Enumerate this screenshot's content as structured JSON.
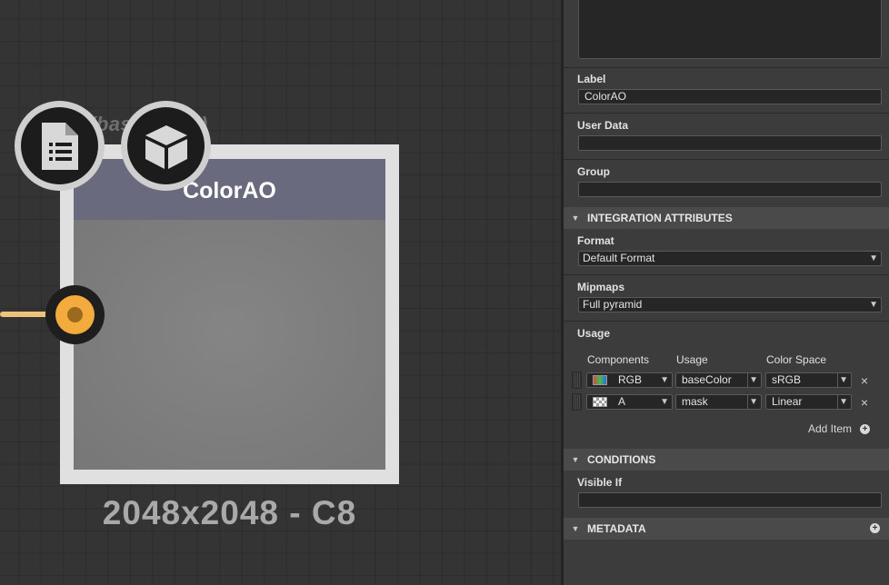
{
  "canvas": {
    "node": {
      "title": "ColorAO",
      "ghost_label": "(base color)",
      "resolution": "2048x2048 - C8",
      "badges": [
        "document-icon",
        "cube-icon"
      ]
    }
  },
  "panel": {
    "label": {
      "title": "Label",
      "value": "ColorAO"
    },
    "user_data": {
      "title": "User Data",
      "value": ""
    },
    "group": {
      "title": "Group",
      "value": ""
    },
    "integration": {
      "header": "INTEGRATION ATTRIBUTES",
      "format": {
        "title": "Format",
        "value": "Default Format"
      },
      "mipmaps": {
        "title": "Mipmaps",
        "value": "Full pyramid"
      },
      "usage": {
        "title": "Usage",
        "columns": [
          "Components",
          "Usage",
          "Color Space"
        ],
        "rows": [
          {
            "component": "RGB",
            "usage": "baseColor",
            "color_space": "sRGB"
          },
          {
            "component": "A",
            "usage": "mask",
            "color_space": "Linear"
          }
        ],
        "add_item": "Add Item"
      }
    },
    "conditions": {
      "header": "CONDITIONS",
      "visible_if": {
        "title": "Visible If",
        "value": ""
      }
    },
    "metadata": {
      "header": "METADATA"
    }
  },
  "colors": {
    "node_header": "#6a6a7e",
    "port": "#f2ab3c",
    "wire": "#efc27c"
  }
}
